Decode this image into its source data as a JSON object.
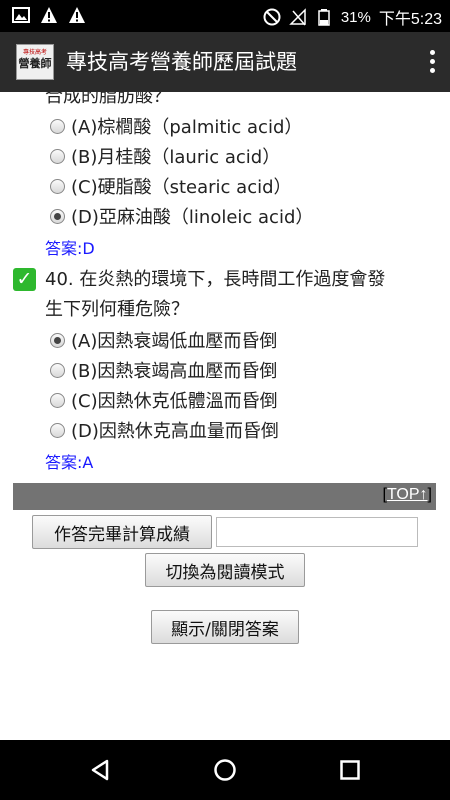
{
  "status_bar": {
    "battery": "31%",
    "time": "下午5:23"
  },
  "app_bar": {
    "logo_small": "專技高考",
    "logo_main": "營養師",
    "title": "專技高考營養師歷屆試題"
  },
  "question_39": {
    "partial_text": "合成的脂肪酸？",
    "options": [
      {
        "label": "(A)棕櫚酸（palmitic acid）",
        "checked": false
      },
      {
        "label": "(B)月桂酸（lauric acid）",
        "checked": false
      },
      {
        "label": "(C)硬脂酸（stearic acid）",
        "checked": false
      },
      {
        "label": "(D)亞麻油酸（linoleic acid）",
        "checked": true
      }
    ],
    "answer": "答案:D"
  },
  "question_40": {
    "check_mark": "✓",
    "line1": "40. 在炎熱的環境下，長時間工作過度會發",
    "line2": "生下列何種危險？",
    "options": [
      {
        "label": "(A)因熱衰竭低血壓而昏倒",
        "checked": true
      },
      {
        "label": "(B)因熱衰竭高血壓而昏倒",
        "checked": false
      },
      {
        "label": "(C)因熱休克低體溫而昏倒",
        "checked": false
      },
      {
        "label": "(D)因熱休克高血量而昏倒",
        "checked": false
      }
    ],
    "answer": "答案:A"
  },
  "top_bar": {
    "bracket_open": "[",
    "link": "TOP↑",
    "bracket_close": "]"
  },
  "buttons": {
    "score": "作答完畢計算成績",
    "score_input": "",
    "reading_mode": "切換為閱讀模式",
    "toggle_answer": "顯示/關閉答案"
  }
}
